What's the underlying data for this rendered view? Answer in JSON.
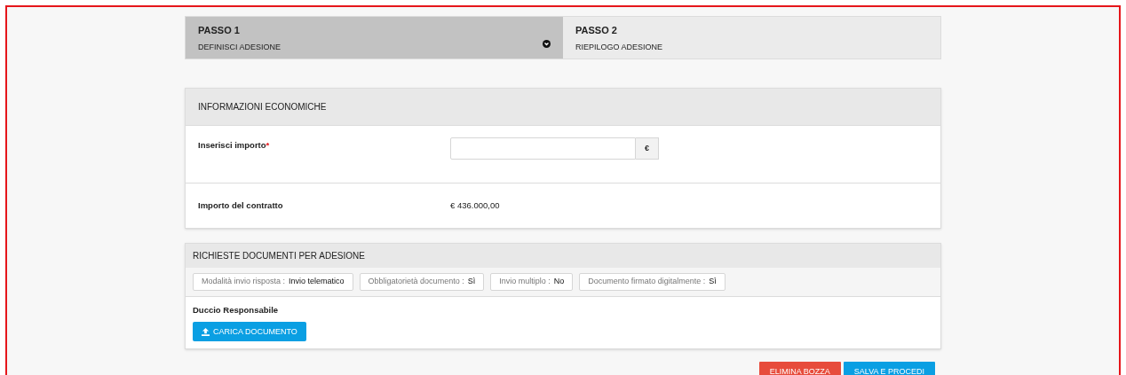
{
  "steps": [
    {
      "title": "PASSO 1",
      "subtitle": "DEFINISCI ADESIONE",
      "selected": true
    },
    {
      "title": "PASSO 2",
      "subtitle": "RIEPILOGO ADESIONE",
      "selected": false
    }
  ],
  "economic_info": {
    "title": "INFORMAZIONI ECONOMICHE",
    "amount_label": "Inserisci importo",
    "required_mark": "*",
    "currency": "€",
    "contract_label": "Importo del contratto",
    "contract_value": "€ 436.000,00"
  },
  "documents": {
    "title": "RICHIESTE DOCUMENTI PER ADESIONE",
    "tags": [
      {
        "label": "Modalità invio risposta :",
        "value": "Invio telematico"
      },
      {
        "label": "Obbligatorietà documento :",
        "value": "Sì"
      },
      {
        "label": "Invio multiplo :",
        "value": "No"
      },
      {
        "label": "Documento firmato digitalmente :",
        "value": "Sì"
      }
    ],
    "document_name": "Duccio Responsabile",
    "upload_button": "CARICA DOCUMENTO"
  },
  "actions": [
    {
      "label": "ELIMINA BOZZA",
      "kind": "danger"
    },
    {
      "label": "SALVA E PROCEDI",
      "kind": "primary"
    }
  ]
}
